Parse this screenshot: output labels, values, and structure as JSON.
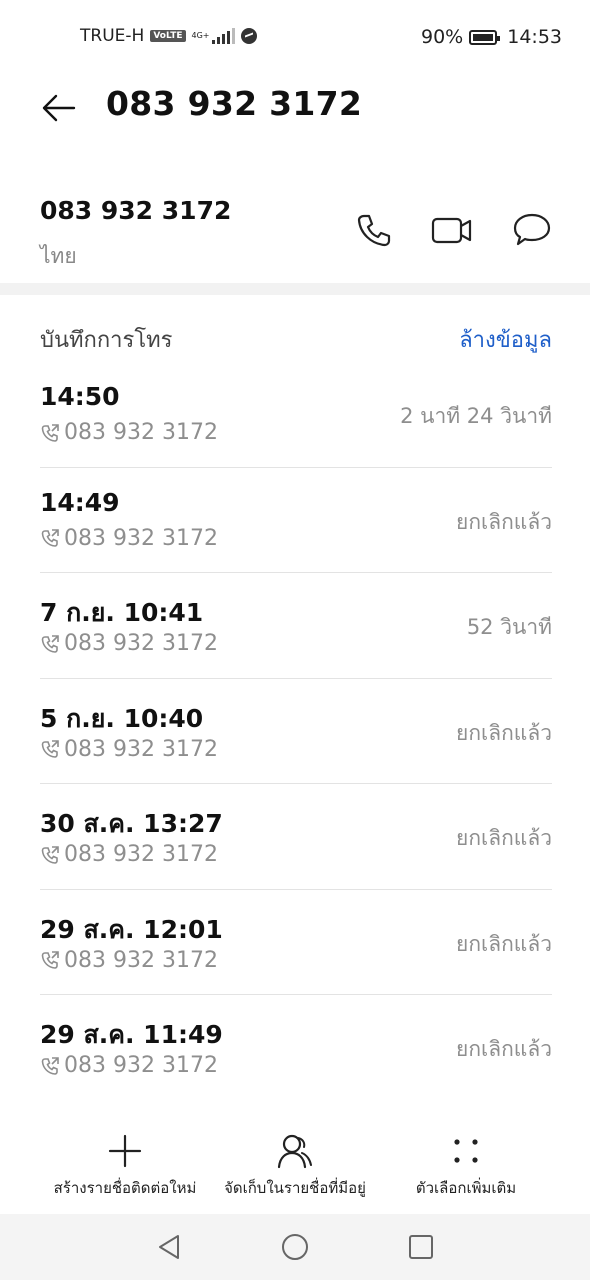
{
  "status_bar": {
    "carrier": "TRUE-H",
    "volte": "VoLTE",
    "network": "4G+",
    "battery": "90%",
    "time": "14:53"
  },
  "header": {
    "title": "083 932 3172"
  },
  "contact": {
    "number": "083 932 3172",
    "location": "ไทย",
    "actions": {
      "call": "phone-icon",
      "video": "video-icon",
      "message": "message-icon"
    }
  },
  "call_log": {
    "title": "บันทึกการโทร",
    "clear_label": "ล้างข้อมูล",
    "entries": [
      {
        "time": "14:50",
        "number": "083 932 3172",
        "status": "2 นาที 24 วินาที"
      },
      {
        "time": "14:49",
        "number": "083 932 3172",
        "status": "ยกเลิกแล้ว"
      },
      {
        "time": "7 ก.ย. 10:41",
        "number": "083 932 3172",
        "status": "52 วินาที"
      },
      {
        "time": "5 ก.ย. 10:40",
        "number": "083 932 3172",
        "status": "ยกเลิกแล้ว"
      },
      {
        "time": "30 ส.ค. 13:27",
        "number": "083 932 3172",
        "status": "ยกเลิกแล้ว"
      },
      {
        "time": "29 ส.ค. 12:01",
        "number": "083 932 3172",
        "status": "ยกเลิกแล้ว"
      },
      {
        "time": "29 ส.ค. 11:49",
        "number": "083 932 3172",
        "status": "ยกเลิกแล้ว"
      }
    ]
  },
  "toolbar": {
    "new_contact": "สร้างรายชื่อติดต่อใหม่",
    "save_existing": "จัดเก็บในรายชื่อที่มีอยู่",
    "more_options": "ตัวเลือกเพิ่มเติม"
  },
  "colors": {
    "accent": "#1f5fc9",
    "secondary_text": "#8e8e8e",
    "divider": "#e3e3e3"
  }
}
